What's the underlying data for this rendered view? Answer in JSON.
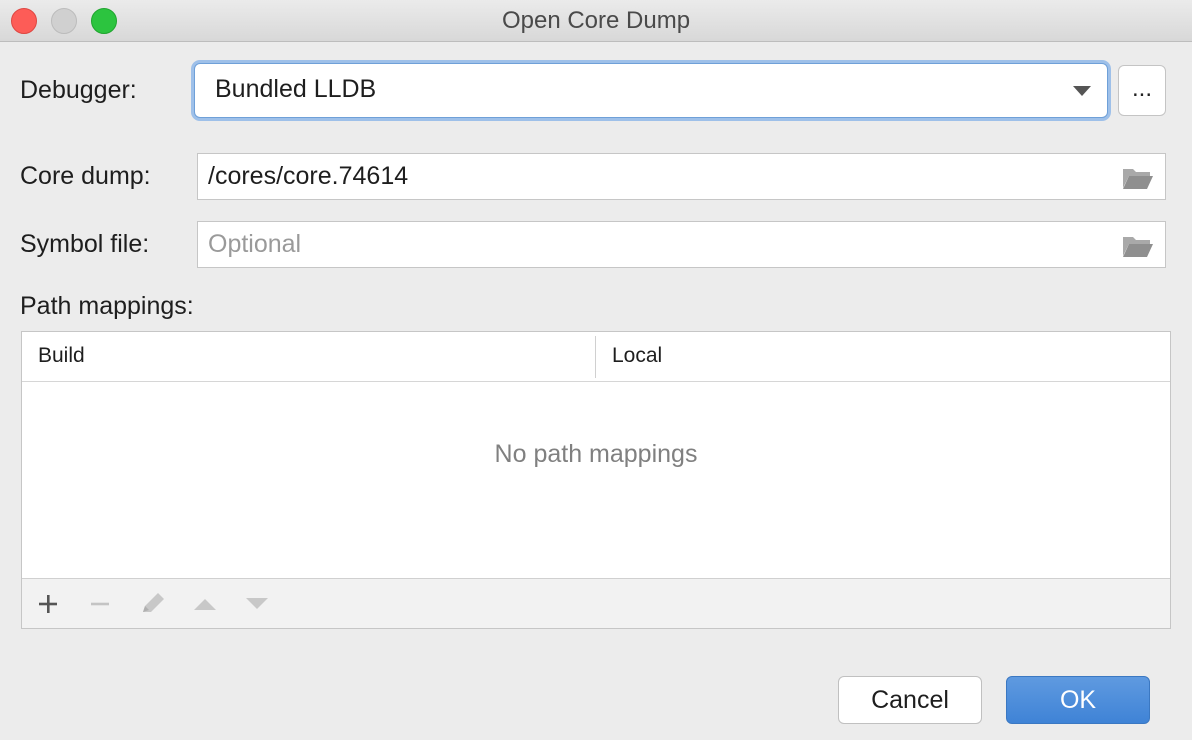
{
  "window": {
    "title": "Open Core Dump"
  },
  "debugger": {
    "label": "Debugger:",
    "selected": "Bundled LLDB",
    "more_label": "..."
  },
  "core_dump": {
    "label": "Core dump:",
    "value": "/cores/core.74614"
  },
  "symbol_file": {
    "label": "Symbol file:",
    "placeholder": "Optional",
    "value": ""
  },
  "path_mappings": {
    "label": "Path mappings:",
    "columns": [
      "Build",
      "Local"
    ],
    "empty_text": "No path mappings",
    "toolbar": [
      "add-icon",
      "remove-icon",
      "edit-icon",
      "move-up-icon",
      "move-down-icon"
    ]
  },
  "buttons": {
    "cancel": "Cancel",
    "ok": "OK"
  },
  "colors": {
    "accent": "#4a8ad8",
    "focus_ring": "#9ec0e9",
    "close": "#fd5c57",
    "maximize": "#2cc43f"
  }
}
